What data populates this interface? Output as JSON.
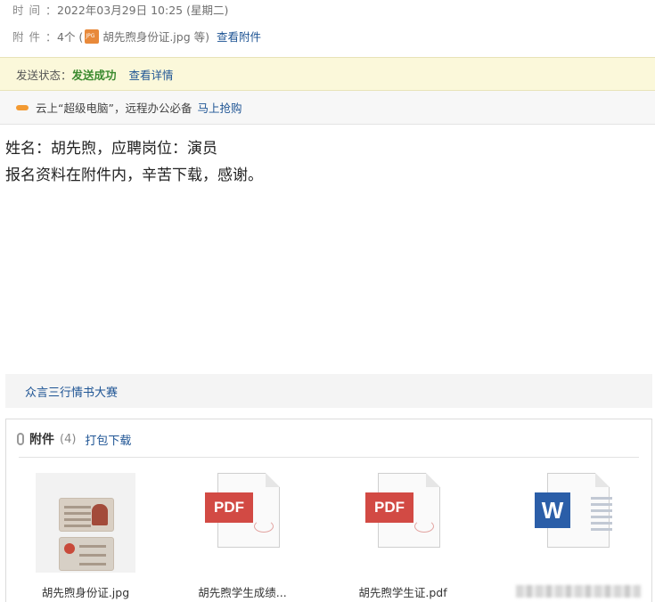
{
  "meta": {
    "time_label": "时间：",
    "time_value": "2022年03月29日 10:25 (星期二)",
    "attach_label": "附件：",
    "attach_prefix": "4个 (",
    "attach_file": "胡先煦身份证.jpg 等)",
    "attach_view_link": "查看附件"
  },
  "status": {
    "label": "发送状态：",
    "value": "发送成功",
    "detail_link": "查看详情"
  },
  "promo": {
    "text": "云上“超级电脑”，远程办公必备",
    "link": "马上抢购"
  },
  "body": {
    "line1": "姓名：胡先煦，应聘岗位：演员",
    "line2": "报名资料在附件内，辛苦下载，感谢。"
  },
  "signature": {
    "link": "众言三行情书大赛"
  },
  "attachments": {
    "title": "附件",
    "count": "(4)",
    "download_all": "打包下载",
    "items": [
      {
        "name": "胡先煦身份证.jpg",
        "icon": "image-thumbnail-icon"
      },
      {
        "name": "胡先煦学生成绩...",
        "icon": "pdf-icon"
      },
      {
        "name": "胡先煦学生证.pdf",
        "icon": "pdf-icon"
      },
      {
        "name": "",
        "icon": "word-icon"
      }
    ]
  },
  "colors": {
    "link": "#1e5494",
    "success": "#3a8a2e",
    "status_bg": "#fbf8da",
    "pdf": "#d24a44",
    "word": "#2b5ea8"
  }
}
